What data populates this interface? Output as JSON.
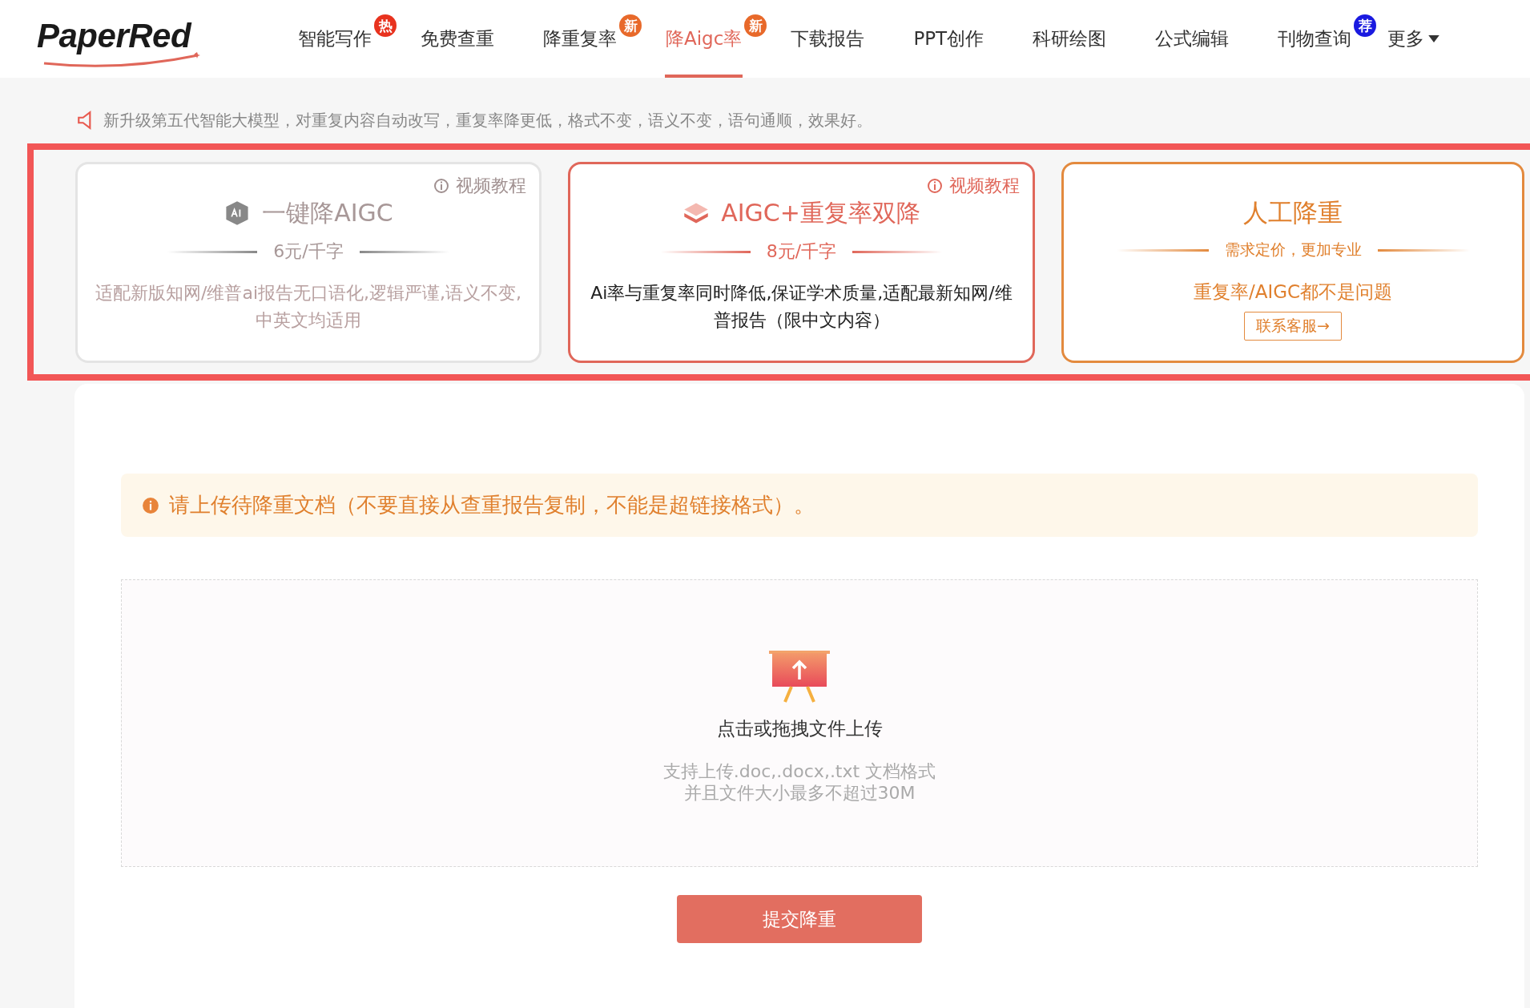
{
  "logo": "PaperRed",
  "nav": [
    {
      "label": "智能写作",
      "selected": false,
      "badge": {
        "text": "热",
        "color": "#e8321e"
      }
    },
    {
      "label": "免费查重",
      "selected": false
    },
    {
      "label": "降重复率",
      "selected": false,
      "badge": {
        "text": "新",
        "color": "#e8692a"
      }
    },
    {
      "label": "降Aigc率",
      "selected": true,
      "badge": {
        "text": "新",
        "color": "#e8692a"
      }
    },
    {
      "label": "下载报告",
      "selected": false
    },
    {
      "label": "PPT创作",
      "selected": false
    },
    {
      "label": "科研绘图",
      "selected": false
    },
    {
      "label": "公式编辑",
      "selected": false
    },
    {
      "label": "刊物查询",
      "selected": false,
      "badge": {
        "text": "荐",
        "color": "#1a1ae0"
      }
    }
  ],
  "more": "更多",
  "notice": "新升级第五代智能大模型，对重复内容自动改写，重复率降更低，格式不变，语义不变，语句通顺，效果好。",
  "cards": [
    {
      "kind": "ai",
      "tutorial": "视频教程",
      "title": "一键降AIGC",
      "price": "6元/千字",
      "description": "适配新版知网/维普ai报告无口语化,逻辑严谨,语义不变,中英文均适用"
    },
    {
      "kind": "combo",
      "tutorial": "视频教程",
      "title": "AIGC+重复率双降",
      "price": "8元/千字",
      "description": "Ai率与重复率同时降低,保证学术质量,适配最新知网/维普报告（限中文内容）"
    },
    {
      "kind": "manual",
      "title": "人工降重",
      "price": "需求定价，更加专业",
      "description": "重复率/AIGC都不是问题",
      "button": "联系客服→"
    }
  ],
  "warning": "请上传待降重文档（不要直接从查重报告复制，不能是超链接格式）。",
  "upload": {
    "label": "点击或拖拽文件上传",
    "hint_lines": [
      "支持上传.doc,.docx,.txt 文档格式",
      "并且文件大小最多不超过30M"
    ]
  },
  "submit": "提交降重"
}
